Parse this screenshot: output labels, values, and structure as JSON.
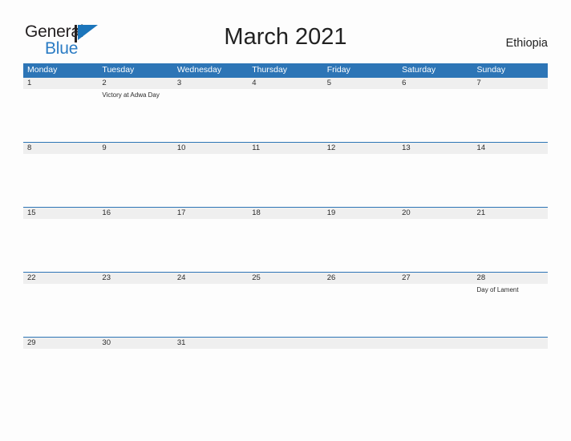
{
  "brand": {
    "name_part1": "General",
    "name_part2": "Blue",
    "flag_icon": "blue-triangle-flag-icon",
    "color_blue": "#2b7cc4",
    "color_black": "#231f20"
  },
  "header": {
    "title": "March 2021",
    "country": "Ethiopia"
  },
  "theme": {
    "header_blue": "#2d75b6",
    "date_band_gray": "#efefef",
    "page_background": "#fdfdfd",
    "text_color": "#2b2b2b"
  },
  "calendar": {
    "month": "March",
    "year": "2021",
    "weekday_headers": [
      "Monday",
      "Tuesday",
      "Wednesday",
      "Thursday",
      "Friday",
      "Saturday",
      "Sunday"
    ],
    "weeks": [
      {
        "days": [
          {
            "date": "1",
            "event": ""
          },
          {
            "date": "2",
            "event": "Victory at Adwa Day"
          },
          {
            "date": "3",
            "event": ""
          },
          {
            "date": "4",
            "event": ""
          },
          {
            "date": "5",
            "event": ""
          },
          {
            "date": "6",
            "event": ""
          },
          {
            "date": "7",
            "event": ""
          }
        ]
      },
      {
        "days": [
          {
            "date": "8",
            "event": ""
          },
          {
            "date": "9",
            "event": ""
          },
          {
            "date": "10",
            "event": ""
          },
          {
            "date": "11",
            "event": ""
          },
          {
            "date": "12",
            "event": ""
          },
          {
            "date": "13",
            "event": ""
          },
          {
            "date": "14",
            "event": ""
          }
        ]
      },
      {
        "days": [
          {
            "date": "15",
            "event": ""
          },
          {
            "date": "16",
            "event": ""
          },
          {
            "date": "17",
            "event": ""
          },
          {
            "date": "18",
            "event": ""
          },
          {
            "date": "19",
            "event": ""
          },
          {
            "date": "20",
            "event": ""
          },
          {
            "date": "21",
            "event": ""
          }
        ]
      },
      {
        "days": [
          {
            "date": "22",
            "event": ""
          },
          {
            "date": "23",
            "event": ""
          },
          {
            "date": "24",
            "event": ""
          },
          {
            "date": "25",
            "event": ""
          },
          {
            "date": "26",
            "event": ""
          },
          {
            "date": "27",
            "event": ""
          },
          {
            "date": "28",
            "event": "Day of Lament"
          }
        ]
      },
      {
        "days": [
          {
            "date": "29",
            "event": ""
          },
          {
            "date": "30",
            "event": ""
          },
          {
            "date": "31",
            "event": ""
          },
          {
            "date": "",
            "event": ""
          },
          {
            "date": "",
            "event": ""
          },
          {
            "date": "",
            "event": ""
          },
          {
            "date": "",
            "event": ""
          }
        ]
      }
    ]
  }
}
